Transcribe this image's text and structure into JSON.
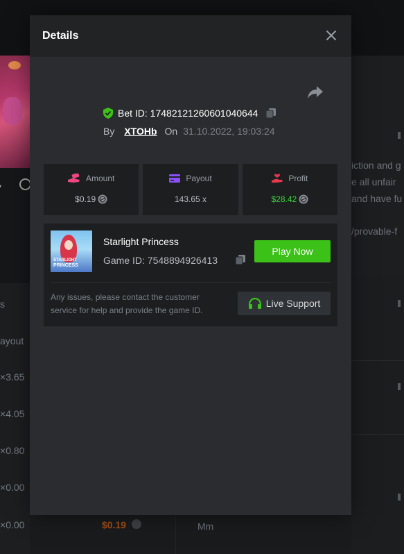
{
  "background": {
    "left_col_labels": [
      "s",
      "ayout",
      "3.65×",
      "4.05×",
      "0.80×",
      "0.00×",
      "0.00×"
    ],
    "right_col_texts": [
      "iction and g",
      "e all unfair",
      "and have fu",
      "/provable-f"
    ],
    "bottom_amount": "$0.19",
    "bottom_label": "Mm"
  },
  "modal": {
    "title": "Details",
    "bet_id": "Bet ID: 17482121260601040644",
    "by_label": "By",
    "username": "XTOHb",
    "on_label": "On",
    "datetime": "31.10.2022, 19:03:24"
  },
  "stats": [
    {
      "label": "Amount",
      "value": "$0.19",
      "icon": "money-hand-icon"
    },
    {
      "label": "Payout",
      "value": "143.65 x",
      "icon": "card-icon"
    },
    {
      "label": "Profit",
      "value": "$28.42",
      "icon": "profit-hand-icon"
    }
  ],
  "game": {
    "name": "Starlight Princess",
    "game_id": "Game ID: 7548894926413",
    "thumb_text_top": "STARLIGHT",
    "thumb_text_bottom": "PRINCESS",
    "play_label": "Play Now",
    "support_text": "Any issues, please contact the customer service for help and provide the game ID.",
    "support_label": "Live Support"
  },
  "colors": {
    "accent_green": "#3bc117",
    "profit_green": "#3cd63a",
    "modal_bg": "#2a2c2f"
  }
}
